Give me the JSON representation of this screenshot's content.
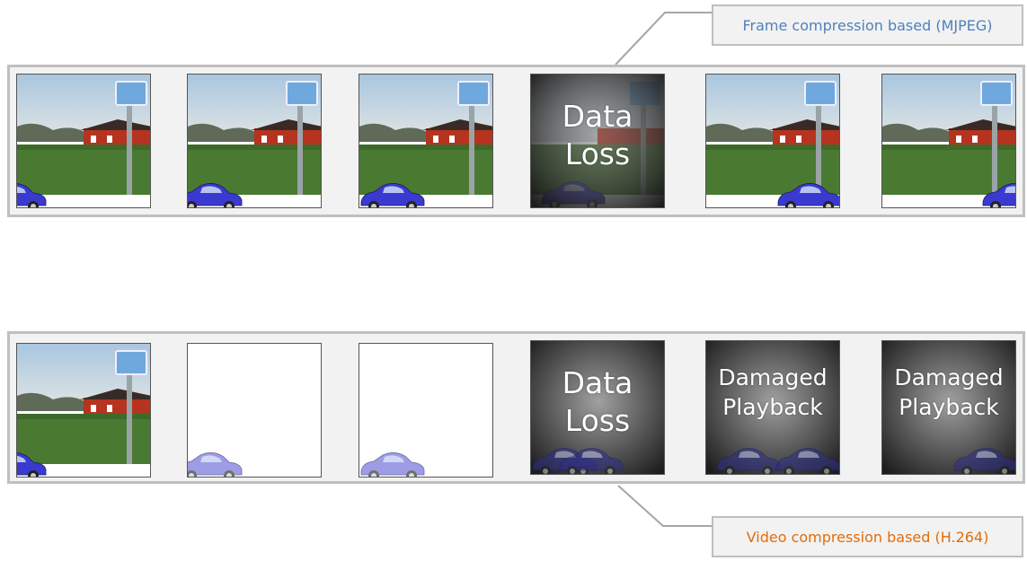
{
  "labels": {
    "top": "Frame compression based (MJPEG)",
    "bottom": "Video compression based (H.264)"
  },
  "colors": {
    "top_label": "#4f81bd",
    "bottom_label": "#e36c09",
    "strip_fill": "#f2f2f2",
    "strip_border": "#bfbfbf",
    "car": "#3a3ad0",
    "barn": "#b5331f",
    "field": "#4a7a32",
    "sky": "#c9dbea"
  },
  "overlays": {
    "data_loss": [
      "Data",
      "Loss"
    ],
    "damaged_playback": [
      "Damaged",
      "Playback"
    ]
  },
  "top_row": [
    "scene",
    "scene",
    "scene",
    "data-loss",
    "scene",
    "scene"
  ],
  "bottom_row": [
    "scene",
    "blank",
    "blank",
    "data-loss",
    "damaged-playback",
    "damaged-playback"
  ]
}
